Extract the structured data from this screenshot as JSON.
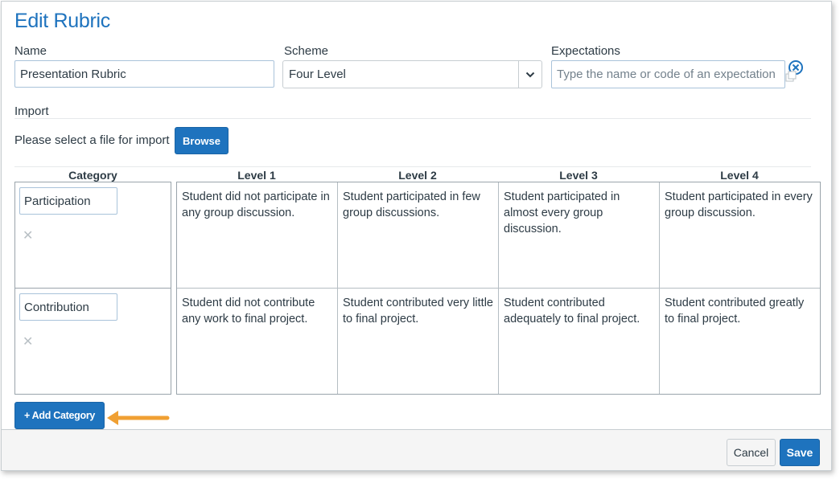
{
  "dialog": {
    "title": "Edit Rubric"
  },
  "fields": {
    "name": {
      "label": "Name",
      "value": "Presentation Rubric"
    },
    "scheme": {
      "label": "Scheme",
      "value": "Four Level"
    },
    "expectations": {
      "label": "Expectations",
      "placeholder": "Type the name or code of an expectation"
    }
  },
  "import": {
    "label": "Import",
    "prompt": "Please select a file for import",
    "browse_label": "Browse"
  },
  "rubric": {
    "category_header": "Category",
    "levels": [
      "Level 1",
      "Level 2",
      "Level 3",
      "Level 4"
    ],
    "categories": [
      {
        "name": "Participation",
        "remove_icon": "close-icon",
        "descriptors": [
          "Student did not participate in any group discussion.",
          "Student participated in few group discussions.",
          "Student participated in almost every group discussion.",
          "Student participated in every group discussion."
        ]
      },
      {
        "name": "Contribution",
        "remove_icon": "close-icon",
        "descriptors": [
          "Student did not contribute any work to final project.",
          "Student contributed very little to final project.",
          "Student contributed adequately to final project.",
          "Student contributed greatly to final project."
        ]
      }
    ],
    "add_category_label": "+ Add Category"
  },
  "footer": {
    "cancel_label": "Cancel",
    "save_label": "Save"
  },
  "colors": {
    "accent": "#1e73be",
    "annotation_arrow": "#f0a033"
  }
}
